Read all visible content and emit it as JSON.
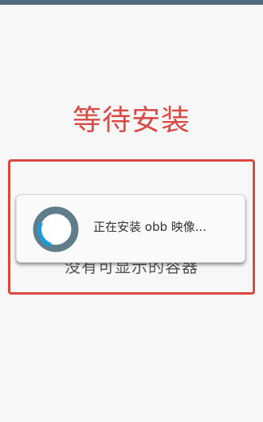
{
  "title": "等待安装",
  "container": {
    "empty_text": "没有可显示的容器"
  },
  "dialog": {
    "message": "正在安装 obb 映像...",
    "spinner_icon": "progress-spinner-icon"
  },
  "colors": {
    "status_bar": "#526b7c",
    "title": "#d94a44",
    "border": "#d9473f",
    "spinner_ring": "#607d8b",
    "spinner_arc": "#1e9bd7"
  }
}
